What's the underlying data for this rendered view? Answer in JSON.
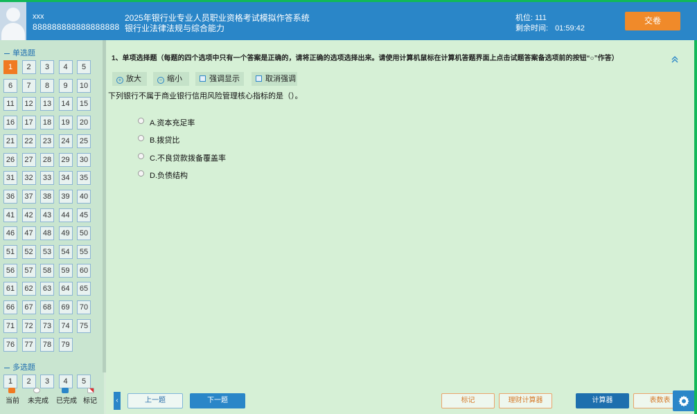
{
  "header": {
    "user_name": "xxx",
    "user_id": "888888888888888888",
    "system_title": "2025年银行业专业人员职业资格考试模拟作答系统",
    "subject": "银行业法律法规与综合能力",
    "seat_label": "机位:",
    "seat_value": "111",
    "remain_label": "剩余时间:",
    "remain_value": "01:59:42",
    "submit_label": "交卷"
  },
  "sidebar": {
    "single_title": "单选题",
    "multi_title": "多选题",
    "single_count": 79,
    "current": 1,
    "multi_visible": [
      "1",
      "2",
      "3",
      "4",
      "5"
    ],
    "legend": {
      "current": "当前",
      "unanswered": "未完成",
      "done": "已完成",
      "marked": "标记"
    }
  },
  "main": {
    "instruction": "1、单项选择题（每题的四个选项中只有一个答案是正确的，请将正确的选项选择出来。请使用计算机鼠标在计算机答题界面上点击试题答案备选项前的按钮“○”作答）",
    "collapse_icon": "double-chevron-up",
    "toolbar": {
      "zoom_in": "放大",
      "zoom_out": "缩小",
      "highlight": "强调显示",
      "unhighlight": "取消强调"
    },
    "question": "下列银行不属于商业银行信用风险管理核心指标的是（）。",
    "options": [
      "A.资本充足率",
      "B.拨贷比",
      "C.不良贷款拨备覆盖率",
      "D.负债结构"
    ]
  },
  "footer": {
    "prev": "上一题",
    "next": "下一题",
    "mark": "标记",
    "finance_calc": "理财计算器",
    "calculator": "计算器",
    "table": "表数表",
    "settings_icon": "gear-icon"
  },
  "colors": {
    "header": "#2a86c8",
    "accent": "#f08a2a",
    "background": "#d6f0d6"
  }
}
